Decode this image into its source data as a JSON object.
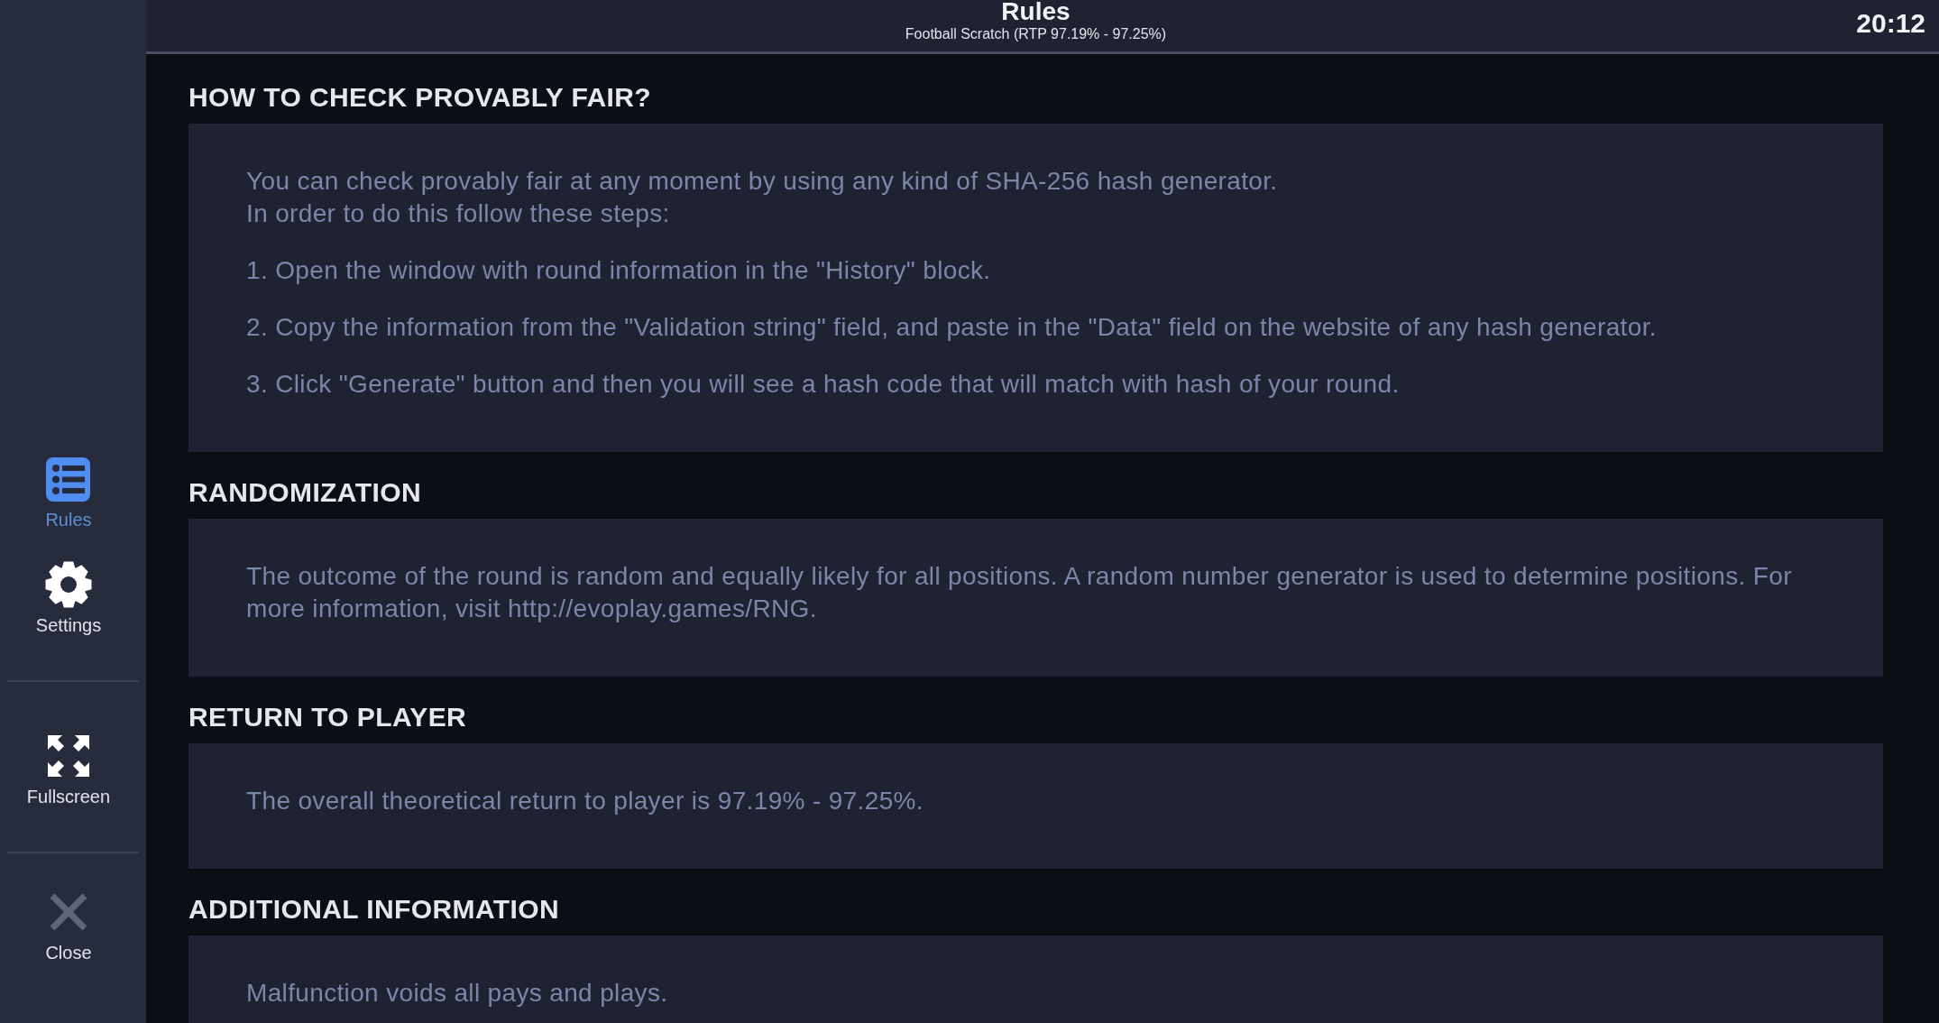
{
  "top_bar": {
    "title": "Rules",
    "subtitle": "Football Scratch (RTP 97.19% - 97.25%)",
    "clock": "20:12"
  },
  "sidebar": {
    "groups": [
      {
        "items": [
          {
            "label": "Rules",
            "selected": true
          },
          {
            "label": "Settings",
            "selected": false
          }
        ]
      },
      {
        "items": [
          {
            "label": "Fullscreen",
            "selected": false
          }
        ]
      },
      {
        "items": [
          {
            "label": "Close",
            "selected": false
          }
        ]
      }
    ]
  },
  "sections": [
    {
      "heading": "HOW TO CHECK PROVABLY FAIR?",
      "paragraphs": [
        "You can check provably fair at any moment by using any kind of SHA-256 hash generator.\nIn order to do this follow these steps:",
        "1. Open the window with round information in the \"History\" block.",
        "2. Copy the information from the \"Validation string\" field, and paste in the \"Data\" field on the website of any hash generator.",
        "3. Click \"Generate\" button and then you will see a hash code that will match with hash of your round."
      ]
    },
    {
      "heading": "RANDOMIZATION",
      "paragraphs": [
        "The outcome of the round is random and equally likely for all positions. A random number generator is used to determine positions. For more information, visit http://evoplay.games/RNG."
      ]
    },
    {
      "heading": "RETURN TO PLAYER",
      "paragraphs": [
        "The overall theoretical return to player is 97.19% - 97.25%."
      ]
    },
    {
      "heading": "ADDITIONAL INFORMATION",
      "paragraphs": [
        "Malfunction voids all pays and plays."
      ]
    }
  ]
}
